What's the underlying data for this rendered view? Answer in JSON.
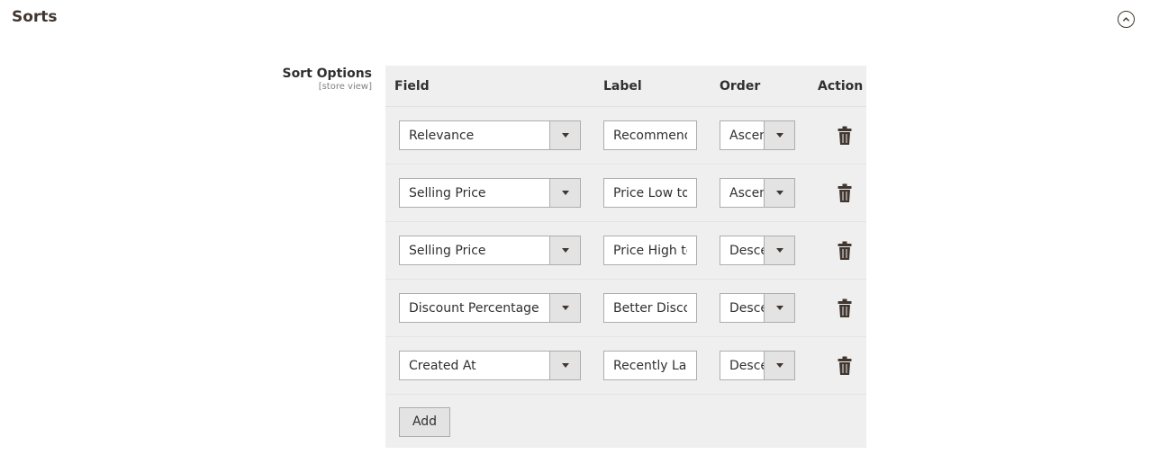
{
  "section": {
    "title": "Sorts",
    "collapse_icon": "chevron-up-circle-icon"
  },
  "field": {
    "label": "Sort Options",
    "scope": "[store view]"
  },
  "grid": {
    "headers": {
      "field": "Field",
      "label": "Label",
      "order": "Order",
      "action": "Action"
    },
    "rows": [
      {
        "field": "Relevance",
        "label": "Recommended",
        "order": "Ascending"
      },
      {
        "field": "Selling Price",
        "label": "Price Low to High",
        "order": "Ascending"
      },
      {
        "field": "Selling Price",
        "label": "Price High to Low",
        "order": "Descending"
      },
      {
        "field": "Discount Percentage",
        "label": "Better Discount",
        "order": "Descending"
      },
      {
        "field": "Created At",
        "label": "Recently Launched",
        "order": "Descending"
      }
    ],
    "delete_icon": "trash-icon",
    "add_label": "Add"
  }
}
